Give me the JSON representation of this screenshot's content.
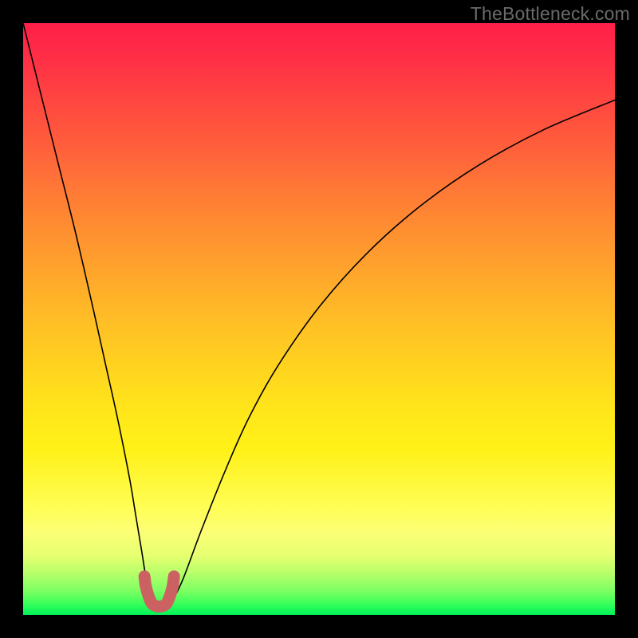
{
  "watermark": "TheBottleneck.com",
  "chart_data": {
    "type": "line",
    "title": "",
    "xlabel": "",
    "ylabel": "",
    "xlim": [
      0,
      100
    ],
    "ylim": [
      0,
      100
    ],
    "series": [
      {
        "name": "bottleneck-curve",
        "x": [
          0,
          3,
          6,
          9,
          12,
          14,
          16,
          18,
          19,
          20,
          21,
          22,
          23,
          24,
          25,
          27,
          30,
          34,
          38,
          43,
          50,
          58,
          67,
          77,
          88,
          100
        ],
        "values": [
          100,
          88,
          76,
          64,
          51,
          42,
          33,
          23,
          17,
          11,
          5,
          2,
          1,
          1,
          2,
          6,
          14,
          24,
          33,
          42,
          52,
          61,
          69,
          76,
          82,
          87
        ]
      },
      {
        "name": "optimal-marker",
        "x": [
          20.5,
          20.7,
          21.0,
          21.5,
          22.0,
          23.0,
          24.0,
          24.5,
          25.0,
          25.3,
          25.5
        ],
        "values": [
          6.5,
          5.0,
          3.8,
          2.4,
          1.7,
          1.4,
          1.7,
          2.4,
          3.8,
          5.0,
          6.5
        ]
      }
    ],
    "colors": {
      "curve": "#000000",
      "marker": "#cb6161",
      "gradient_top": "#ff1f49",
      "gradient_bottom": "#00f45a"
    }
  }
}
